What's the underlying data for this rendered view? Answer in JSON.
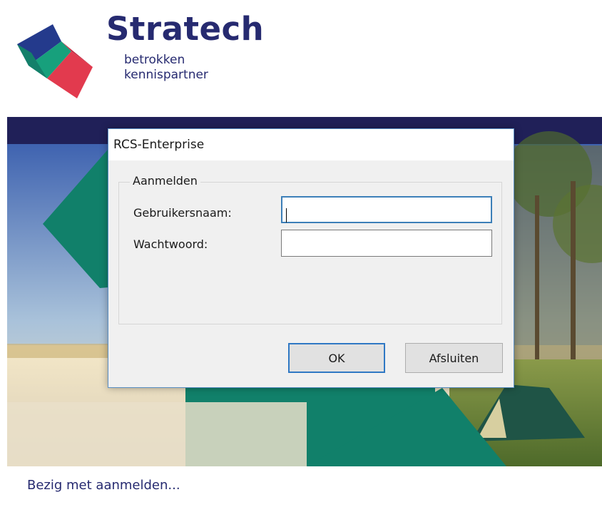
{
  "brand": {
    "name": "Stratech",
    "tagline_line1": "betrokken",
    "tagline_line2": "kennispartner"
  },
  "dialog": {
    "title": "RCS-Enterprise",
    "group_legend": "Aanmelden",
    "username_label": "Gebruikersnaam:",
    "username_value": "",
    "password_label": "Wachtwoord:",
    "password_value": "",
    "ok_label": "OK",
    "exit_label": "Afsluiten"
  },
  "status_text": "Bezig met aanmelden...",
  "colors": {
    "brand_navy": "#262a70",
    "banner_teal": "#11806a",
    "dialog_background": "#f0f0f0",
    "focus_border": "#3c7fb8"
  }
}
